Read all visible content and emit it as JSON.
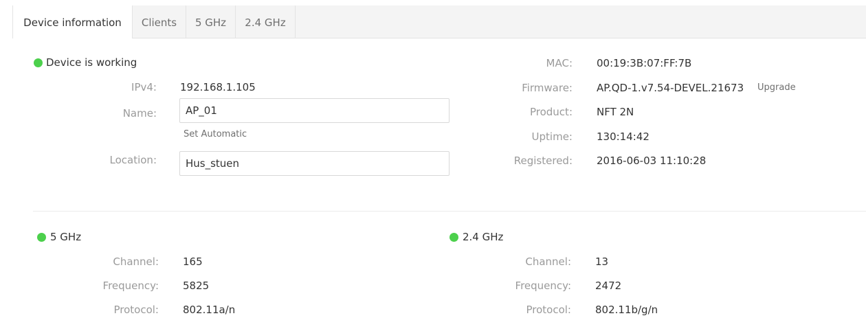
{
  "tabs": [
    {
      "label": "Device information",
      "active": true
    },
    {
      "label": "Clients",
      "active": false
    },
    {
      "label": "5 GHz",
      "active": false
    },
    {
      "label": "2.4 GHz",
      "active": false
    }
  ],
  "status": {
    "text": "Device is working",
    "color": "#4cd04c"
  },
  "left": {
    "ipv4_label": "IPv4:",
    "ipv4_value": "192.168.1.105",
    "name_label": "Name:",
    "name_value": "AP_01",
    "set_automatic": "Set Automatic",
    "location_label": "Location:",
    "location_value": "Hus_stuen"
  },
  "right": {
    "mac_label": "MAC:",
    "mac_value": "00:19:3B:07:FF:7B",
    "firmware_label": "Firmware:",
    "firmware_value": "AP.QD-1.v7.54-DEVEL.21673",
    "upgrade_label": "Upgrade",
    "product_label": "Product:",
    "product_value": "NFT 2N",
    "uptime_label": "Uptime:",
    "uptime_value": "130:14:42",
    "registered_label": "Registered:",
    "registered_value": "2016-06-03 11:10:28"
  },
  "radio5": {
    "title": "5 GHz",
    "channel_label": "Channel:",
    "channel_value": "165",
    "frequency_label": "Frequency:",
    "frequency_value": "5825",
    "protocol_label": "Protocol:",
    "protocol_value": "802.11a/n"
  },
  "radio24": {
    "title": "2.4 GHz",
    "channel_label": "Channel:",
    "channel_value": "13",
    "frequency_label": "Frequency:",
    "frequency_value": "2472",
    "protocol_label": "Protocol:",
    "protocol_value": "802.11b/g/n"
  }
}
